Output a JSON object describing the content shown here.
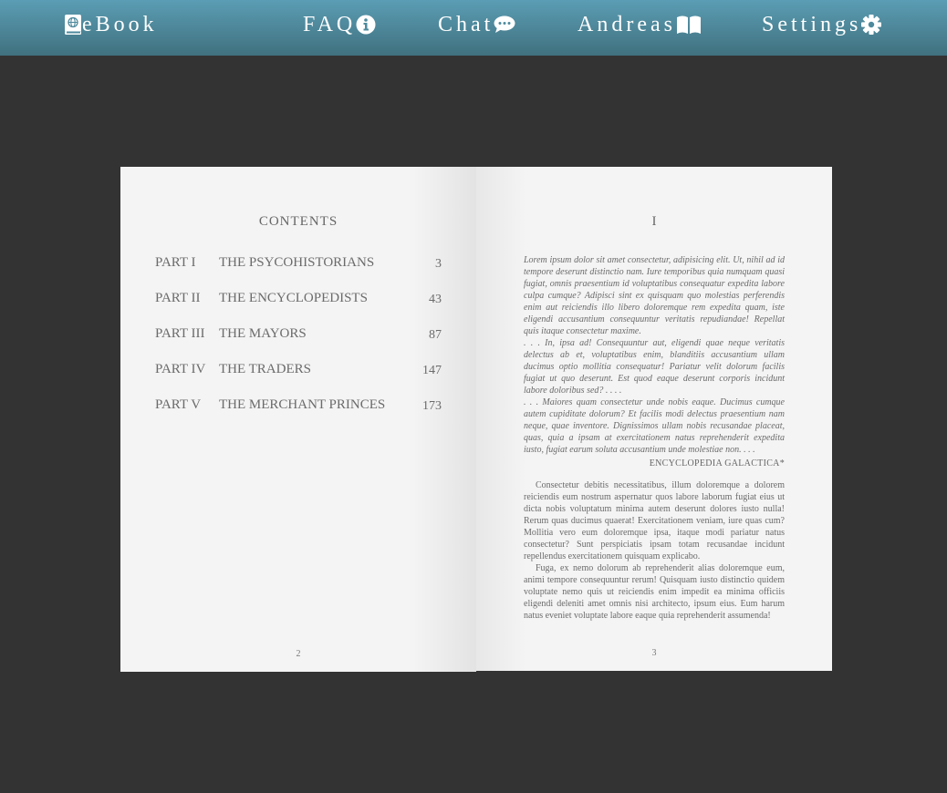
{
  "nav": {
    "ebook": "eBook",
    "faq": "FAQ",
    "chat": "Chat",
    "andreas": "Andreas",
    "settings": "Settings"
  },
  "icons": {
    "ebook": "book-globe-icon",
    "faq": "info-circle-icon",
    "chat": "chat-bubble-icon",
    "andreas": "open-book-icon",
    "settings": "gear-icon"
  },
  "colors": {
    "nav_top": "#5b9db4",
    "nav_bottom": "#40717f",
    "background": "#333333",
    "page": "#f4f4f4"
  },
  "left_page": {
    "heading": "CONTENTS",
    "toc": [
      {
        "part": "PART I",
        "title": "THE PSYCOHISTORIANS",
        "page": "3"
      },
      {
        "part": "PART II",
        "title": "THE ENCYCLOPEDISTS",
        "page": "43"
      },
      {
        "part": "PART III",
        "title": "THE MAYORS",
        "page": "87"
      },
      {
        "part": "PART IV",
        "title": "THE TRADERS",
        "page": "147"
      },
      {
        "part": "PART V",
        "title": "THE MERCHANT PRINCES",
        "page": "173"
      }
    ],
    "folio": "2"
  },
  "right_page": {
    "chapter": "I",
    "epigraph": [
      "Lorem ipsum dolor sit amet consectetur, adipisicing elit. Ut, nihil ad id tempore deserunt distinctio nam. Iure temporibus quia numquam quasi fugiat, omnis praesentium id voluptatibus consequatur expedita labore culpa cumque? Adipisci sint ex quisquam quo molestias perferendis enim aut reiciendis illo libero doloremque rem expedita quam, iste eligendi accusantium consequuntur veritatis repudiandae! Repellat quis itaque consectetur maxime.",
      ". . . In, ipsa ad! Consequuntur aut, eligendi quae neque veritatis delectus ab et, voluptatibus enim, blanditiis accusantium ullam ducimus optio mollitia consequatur! Pariatur velit dolorum facilis fugiat ut quo deserunt. Est quod eaque deserunt corporis incidunt labore doloribus sed? . . . .",
      ". . . Maiores quam consectetur unde nobis eaque. Ducimus cumque autem cupiditate dolorum? Et facilis modi delectus praesentium nam neque, quae inventore. Dignissimos ullam nobis recusandae placeat, quas, quia a ipsam at exercitationem natus reprehenderit expedita iusto, fugiat earum soluta accusantium unde molestiae non. . . ."
    ],
    "attribution": "ENCYCLOPEDIA GALACTICA*",
    "body": [
      "Consectetur debitis necessitatibus, illum doloremque a dolorem reiciendis eum nostrum aspernatur quos labore laborum fugiat eius ut dicta nobis voluptatum minima autem deserunt dolores iusto nulla! Rerum quas ducimus quaerat! Exercitationem veniam, iure quas cum? Mollitia vero eum doloremque ipsa, itaque modi pariatur natus consectetur? Sunt perspiciatis ipsam totam recusandae incidunt repellendus exercitationem quisquam explicabo.",
      "Fuga, ex nemo dolorum ab reprehenderit alias doloremque eum, animi tempore consequuntur rerum! Quisquam iusto distinctio quidem voluptate nemo quis ut reiciendis enim impedit ea minima officiis eligendi deleniti amet omnis nisi architecto, ipsum eius. Eum harum natus eveniet voluptate labore eaque quia reprehenderit assumenda!"
    ],
    "folio": "3"
  }
}
